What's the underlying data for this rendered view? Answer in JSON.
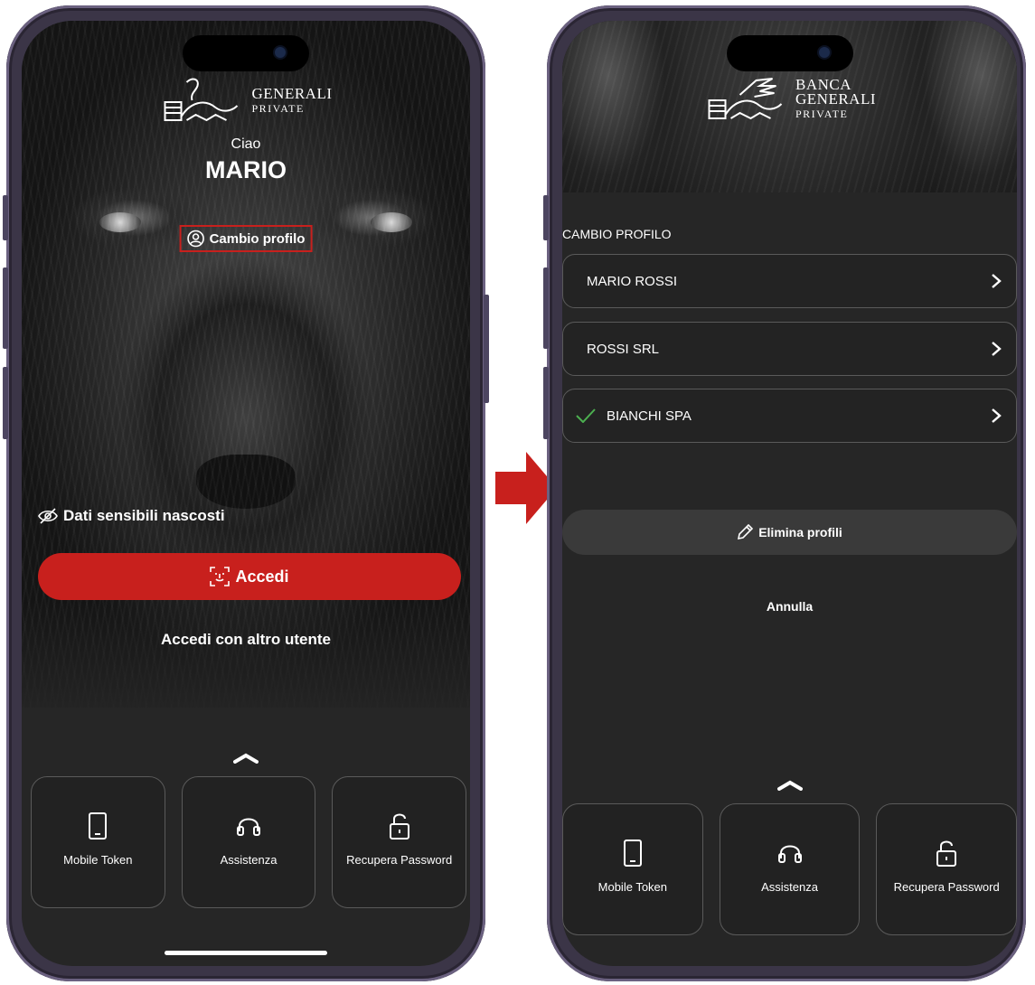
{
  "left_screen": {
    "logo": {
      "line1": "GENERALI",
      "line2": "PRIVATE"
    },
    "greeting": "Ciao",
    "user_name": "MARIO",
    "switch_profile_label": "Cambio profilo",
    "sensitive_data_label": "Dati sensibili nascosti",
    "login_button_label": "Accedi",
    "alt_login_label": "Accedi con altro utente",
    "tiles": [
      {
        "label": "Mobile Token",
        "icon": "phone-icon"
      },
      {
        "label": "Assistenza",
        "icon": "headset-icon"
      },
      {
        "label": "Recupera Password",
        "icon": "unlock-icon"
      }
    ]
  },
  "right_screen": {
    "logo": {
      "line1": "BANCA",
      "line2": "GENERALI",
      "line3": "PRIVATE"
    },
    "section_title": "CAMBIO PROFILO",
    "profiles": [
      {
        "label": "MARIO ROSSI",
        "selected": false
      },
      {
        "label": "ROSSI SRL",
        "selected": false
      },
      {
        "label": "BIANCHI SPA",
        "selected": true
      }
    ],
    "delete_profiles_label": "Elimina profili",
    "cancel_label": "Annulla",
    "tiles": [
      {
        "label": "Mobile Token",
        "icon": "phone-icon"
      },
      {
        "label": "Assistenza",
        "icon": "headset-icon"
      },
      {
        "label": "Recupera Password",
        "icon": "unlock-icon"
      }
    ]
  },
  "colors": {
    "accent_red": "#c8201d",
    "screen_bg": "#262626",
    "check_green": "#4caf50",
    "frame": "#3b3547"
  }
}
